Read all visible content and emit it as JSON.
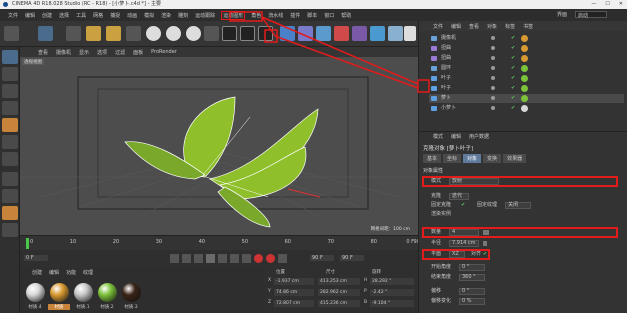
{
  "window": {
    "title": "CINEMA 4D R18.028 Studio (RC - R18) - [小萝卜.c4d *] - 主要",
    "min": "—",
    "max": "☐",
    "close": "✕"
  },
  "menu": {
    "items": [
      "文件",
      "编辑",
      "创建",
      "选择",
      "工具",
      "网格",
      "捕捉",
      "动画",
      "模拟",
      "渲染",
      "雕刻",
      "运动跟踪",
      "运动图形",
      "角色",
      "流水线",
      "插件",
      "脚本",
      "窗口",
      "帮助"
    ],
    "highlighted_index": 12,
    "layout_label": "界面",
    "layout_value": "启动"
  },
  "viewport": {
    "menu": [
      "查看",
      "摄像机",
      "显示",
      "选项",
      "过滤",
      "面板",
      "ProRender"
    ],
    "label": "透视视图",
    "grid_text": "网格间距：100 cm"
  },
  "timeline": {
    "ticks": [
      "0",
      "10",
      "20",
      "30",
      "40",
      "50",
      "60",
      "70",
      "80",
      "90"
    ],
    "frame": "0 F"
  },
  "playback": {
    "start": "0 F",
    "end": "90 F",
    "current": "90 F"
  },
  "materials": {
    "menu": [
      "创建",
      "编辑",
      "功能",
      "纹理"
    ],
    "items": [
      "材质.4",
      "材质",
      "材质.1",
      "材质.2",
      "材质.3"
    ],
    "colors": [
      "#d8d8d8",
      "#d89a30",
      "#c8c8c8",
      "#7cc13a",
      "#3a2418"
    ]
  },
  "coords": {
    "headers": [
      "位置",
      "尺寸",
      "旋转"
    ],
    "rows": [
      {
        "axis": "X",
        "pos": "-1.937 cm",
        "size": "413.253 cm",
        "rot_axis": "H",
        "rot": "28.292 °"
      },
      {
        "axis": "Y",
        "pos": "74.86 cm",
        "size": "282.962 cm",
        "rot_axis": "P",
        "rot": "-2.42 °"
      },
      {
        "axis": "Z",
        "pos": "72.807 cm",
        "size": "415.236 cm",
        "rot_axis": "B",
        "rot": "-9.104 °"
      }
    ]
  },
  "objects": {
    "menu": [
      "文件",
      "编辑",
      "查看",
      "对象",
      "标签",
      "书签"
    ],
    "rows": [
      {
        "name": "摄像机",
        "color": "#6aa2d8"
      },
      {
        "name": "扭曲",
        "color": "#9a7bd4"
      },
      {
        "name": "扭曲",
        "color": "#9a7bd4"
      },
      {
        "name": "圆环",
        "color": "#6aa2d8"
      },
      {
        "name": "叶子",
        "color": "#5fa0e0"
      },
      {
        "name": "叶子",
        "color": "#5fa0e0"
      },
      {
        "name": "萝卜",
        "color": "#5fa0e0"
      },
      {
        "name": "小萝卜",
        "color": "#5fa0e0"
      }
    ]
  },
  "attributes": {
    "menu": [
      "模式",
      "编辑",
      "用户数据"
    ],
    "title": "克隆对象 [萝卜叶子]",
    "tabs": [
      "基本",
      "坐标",
      "对象",
      "变换",
      "效果器"
    ],
    "active_tab": 2,
    "section": "对象属性",
    "mode_label": "模式",
    "mode_value": "放射",
    "clone_label": "克隆",
    "clone_value": "迭代",
    "fix_clone_label": "固定克隆",
    "fix_texture_label": "固定纹理",
    "fix_texture_value": "关闭",
    "instance_label": "渲染实例",
    "count_label": "数量",
    "count_value": "4",
    "radius_label": "半径",
    "radius_value": "7.914 cm",
    "plane_label": "平面",
    "plane_value": "XZ",
    "align_label": "对齐",
    "start_label": "开始角度",
    "start_value": "0 °",
    "end_label": "结束角度",
    "end_value": "360 °",
    "offset_label": "偏移",
    "offset_value": "0 °",
    "offset_var_label": "偏移变化",
    "offset_var_value": "0 %"
  }
}
